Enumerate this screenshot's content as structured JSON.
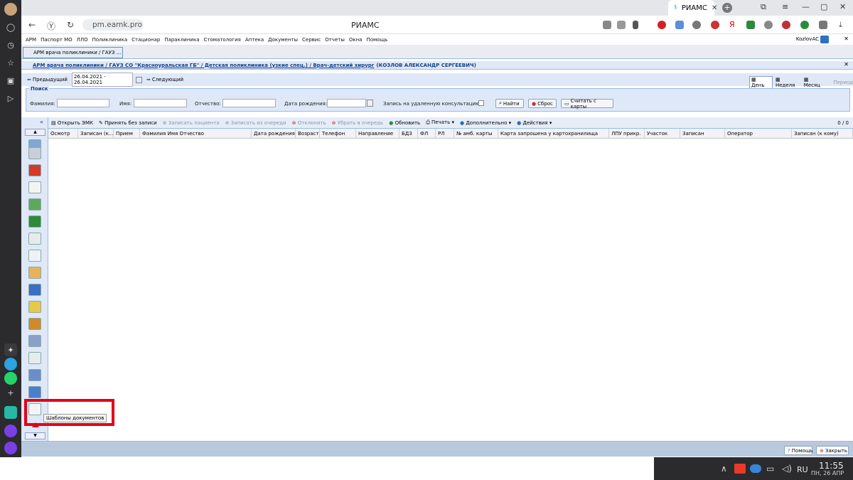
{
  "browser": {
    "tab_title": "РИАМС",
    "tab_close": "✕",
    "new_tab": "+",
    "url": "pm.eamk.pro",
    "page_title": "РИАМС"
  },
  "menu": [
    "АРМ",
    "Паспорт МО",
    "ЛЛО",
    "Поликлиника",
    "Стационар",
    "Параклиника",
    "Стоматология",
    "Аптека",
    "Документы",
    "Сервис",
    "Отчеты",
    "Окна",
    "Помощь"
  ],
  "user": "KozlovAC",
  "window_tab": "АРМ врача поликлиники / ГАУЗ ...",
  "breadcrumb": {
    "part1": "АРМ врача поликлиники / ГАУЗ СО \"Красноуральская ГБ\" / Детская поликлиника (узкие спец.) / Врач-детский хирург",
    "part2": "(КОЗЛОВ АЛЕКСАНДР СЕРГЕЕВИЧ)"
  },
  "datebar": {
    "prev": "Предыдущий",
    "range": "26.04.2021 - 26.04.2021",
    "next": "Следующий",
    "day": "День",
    "week": "Неделя",
    "month": "Месяц",
    "period": "Период"
  },
  "search": {
    "legend": "Поиск",
    "surname": "Фамилия:",
    "name": "Имя:",
    "patronymic": "Отчество:",
    "birthdate": "Дата рождения:",
    "remote": "Запись на удаленную консультацию:",
    "find": "Найти",
    "reset": "Сброс",
    "read_card": "Считать с карты"
  },
  "toolbar": {
    "open_emk": "Открыть ЭМК",
    "accept": "Принять без записи",
    "enroll": "Записать пациента",
    "queue": "Записать из очереди",
    "reject": "Отклонить",
    "remove_queue": "Убрать в очередь",
    "refresh": "Обновить",
    "print": "Печать",
    "more": "Дополнительно",
    "actions": "Действия",
    "counter": "0 / 0"
  },
  "columns": [
    "Осмотр",
    "Записан (к...",
    "Прием",
    "Фамилия Имя Отчество",
    "Дата рождения",
    "Возраст",
    "Телефон",
    "Направление",
    "БДЗ",
    "ФЛ",
    "РЛ",
    "№ амб. карты",
    "Карта запрошена у картохранилища",
    "ЛПУ прикр.",
    "Участок",
    "Записан",
    "Оператор",
    "Записан (к кому)"
  ],
  "tooltip": "Шаблоны документов",
  "bottom": {
    "help": "Помощь",
    "close": "Закрыть"
  },
  "taskbar": {
    "lang": "RU",
    "time": "11:55",
    "date": "ПН, 26 АПР"
  },
  "colors": {
    "highlight": "#e2001a",
    "panel": "#dfe8f6",
    "border": "#99bbe8"
  }
}
